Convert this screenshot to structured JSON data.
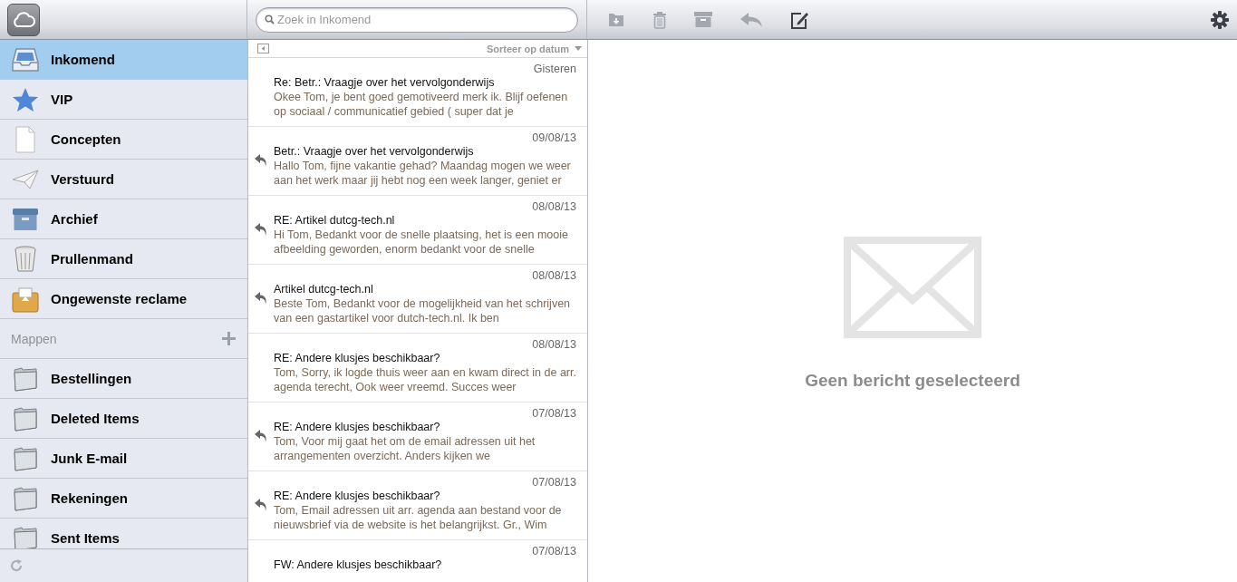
{
  "search": {
    "placeholder": "Zoek in Inkomend"
  },
  "toolbar": [
    {
      "kind": "move",
      "disabled": true
    },
    {
      "kind": "trash",
      "disabled": true
    },
    {
      "kind": "archive",
      "disabled": true
    },
    {
      "kind": "reply",
      "disabled": true
    },
    {
      "kind": "compose",
      "disabled": false
    }
  ],
  "mailboxes": [
    {
      "kind": "inbox",
      "label": "Inkomend",
      "selected": true
    },
    {
      "kind": "vip",
      "label": "VIP",
      "selected": false
    },
    {
      "kind": "drafts",
      "label": "Concepten",
      "selected": false
    },
    {
      "kind": "sent",
      "label": "Verstuurd",
      "selected": false
    },
    {
      "kind": "archive",
      "label": "Archief",
      "selected": false
    },
    {
      "kind": "trash",
      "label": "Prullenmand",
      "selected": false
    },
    {
      "kind": "junk",
      "label": "Ongewenste reclame",
      "selected": false
    }
  ],
  "folders_header": "Mappen",
  "folders": [
    {
      "label": "Bestellingen",
      "selected": false
    },
    {
      "label": "Deleted Items",
      "selected": false
    },
    {
      "label": "Junk E-mail",
      "selected": false
    },
    {
      "label": "Rekeningen",
      "selected": false
    },
    {
      "label": "Sent Items",
      "selected": false
    }
  ],
  "sort": "Sorteer op datum",
  "messages": [
    {
      "date": "Gisteren",
      "subject": "Re: Betr.: Vraagje over het vervolgonderwijs",
      "preview": "Okee Tom, je bent goed gemotiveerd merk ik. Blijf oefenen op sociaal / communicatief gebied ( super dat je",
      "replied": false
    },
    {
      "date": "09/08/13",
      "subject": "Betr.: Vraagje over het vervolgonderwijs",
      "preview": "Hallo Tom, fijne vakantie gehad? Maandag mogen we weer aan het werk maar jij hebt nog een week langer, geniet er",
      "replied": true
    },
    {
      "date": "08/08/13",
      "subject": "RE: Artikel dutcg-tech.nl",
      "preview": "Hi Tom, Bedankt voor de snelle plaatsing, het is een mooie afbeelding geworden, enorm bedankt voor de snelle",
      "replied": true
    },
    {
      "date": "08/08/13",
      "subject": "Artikel dutcg-tech.nl",
      "preview": "Beste Tom, Bedankt voor de mogelijkheid van het schrijven van een gastartikel voor dutch-tech.nl. Ik ben",
      "replied": true
    },
    {
      "date": "08/08/13",
      "subject": "RE: Andere klusjes beschikbaar?",
      "preview": "Tom, Sorry, ik logde thuis weer aan en kwam direct in de arr. agenda terecht, Ook weer vreemd. Succes weer",
      "replied": false
    },
    {
      "date": "07/08/13",
      "subject": "RE: Andere klusjes beschikbaar?",
      "preview": "Tom, Voor mij gaat het om de email adressen uit het arrangementen overzicht. Anders kijken we",
      "replied": true
    },
    {
      "date": "07/08/13",
      "subject": "RE: Andere klusjes beschikbaar?",
      "preview": "Tom, Email adressen uit arr. agenda aan bestand voor de nieuwsbrief via de website is het belangrijkst. Gr., Wim",
      "replied": true
    },
    {
      "date": "07/08/13",
      "subject": "FW: Andere klusjes beschikbaar?",
      "replied": false
    }
  ],
  "reading_pane": {
    "empty_text": "Geen bericht geselecteerd"
  }
}
